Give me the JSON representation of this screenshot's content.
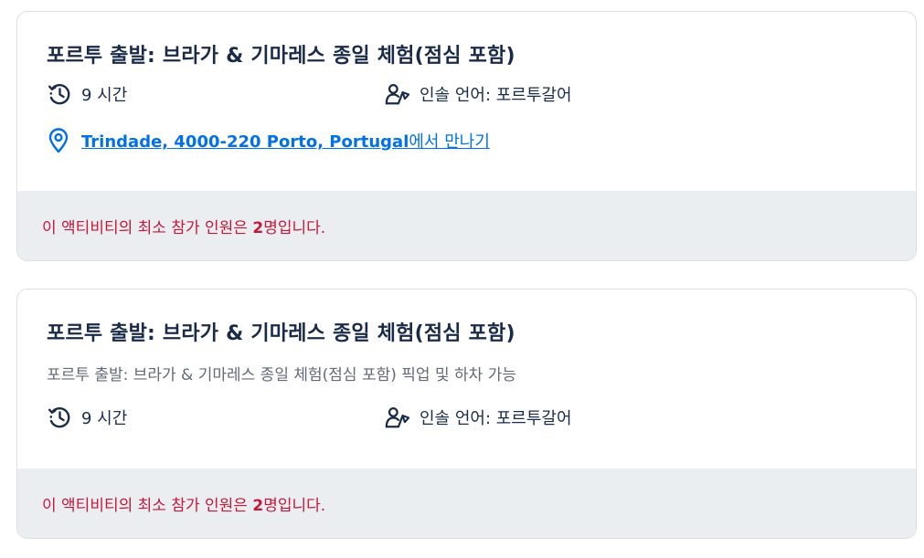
{
  "options": [
    {
      "title": "포르투 출발: 브라가 & 기마레스 종일 체험(점심 포함)",
      "subtitle": "",
      "duration": "9 시간",
      "language": "인솔 언어: 포르투갈어",
      "meeting_point": {
        "address": "Trindade, 4000-220 Porto, Portugal",
        "suffix": "에서 만나기"
      },
      "notice": {
        "prefix": "이 액티비티의 최소 참가 인원은 ",
        "count": "2",
        "suffix": "명입니다."
      }
    },
    {
      "title": "포르투 출발: 브라가 & 기마레스 종일 체험(점심 포함)",
      "subtitle": "포르투 출발: 브라가 & 기마레스 종일 체험(점심 포함) 픽업 및 하차 가능",
      "duration": "9 시간",
      "language": "인솔 언어: 포르투갈어",
      "notice": {
        "prefix": "이 액티비티의 최소 참가 인원은 ",
        "count": "2",
        "suffix": "명입니다."
      }
    }
  ],
  "icons": {
    "duration": "clock-history-icon",
    "language": "guide-person-flag-icon",
    "location": "map-pin-icon"
  },
  "colors": {
    "text": "#1a2b49",
    "link": "#0071eb",
    "notice": "#c7163a",
    "notice_bg": "#ebeef1",
    "border": "#dcdfe4"
  }
}
